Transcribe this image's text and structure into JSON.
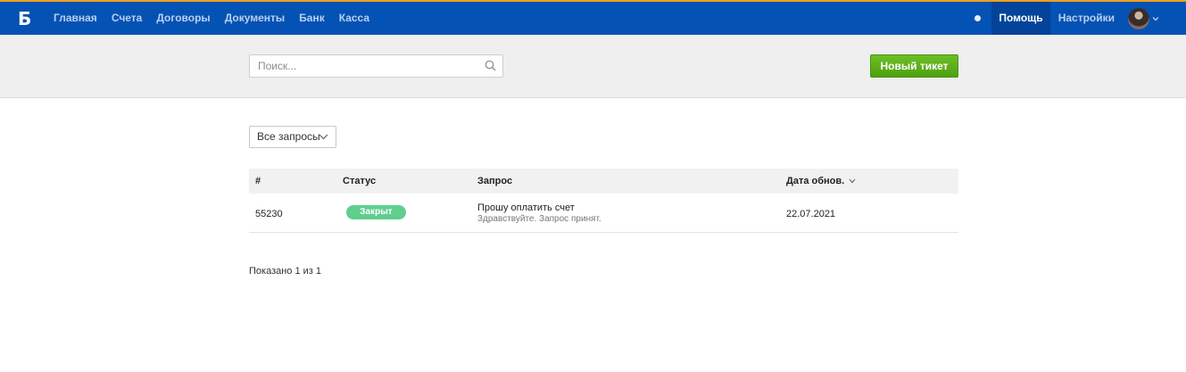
{
  "topbar": {
    "logo_letter": "Б",
    "nav": [
      "Главная",
      "Счета",
      "Договоры",
      "Документы",
      "Банк",
      "Касса"
    ],
    "help_label": "Помощь",
    "settings_label": "Настройки",
    "accent_color": "#0552b5"
  },
  "search": {
    "placeholder": "Поиск...",
    "value": ""
  },
  "new_ticket_label": "Новый тикет",
  "filter": {
    "selected": "Все запросы"
  },
  "table": {
    "columns": {
      "id": "#",
      "status": "Статус",
      "request": "Запрос",
      "updated": "Дата обнов."
    },
    "rows": [
      {
        "id": "55230",
        "status": "Закрыт",
        "status_color": "#5fcf8e",
        "title": "Прошу оплатить счет",
        "preview": "Здравствуйте. Запрос принят.",
        "updated": "22.07.2021"
      }
    ]
  },
  "footer": {
    "shown": "Показано 1 из 1"
  }
}
